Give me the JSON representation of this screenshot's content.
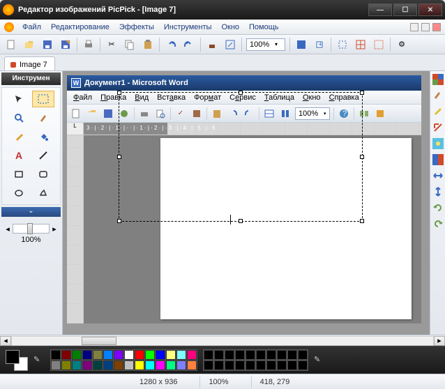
{
  "window": {
    "title": "Редактор изображений PicPick - [Image 7]"
  },
  "menu": {
    "file": "Файл",
    "edit": "Редактирование",
    "effects": "Эффекты",
    "tools": "Инструменты",
    "window": "Окно",
    "help": "Помощь"
  },
  "toolbar": {
    "zoom_value": "100%"
  },
  "tabs": {
    "tab1": "Image 7"
  },
  "toolpanel": {
    "header": "Инструмен",
    "size_value": "100%"
  },
  "embedded": {
    "title": "Документ1 - Microsoft Word",
    "menu": {
      "file": "Файл",
      "edit": "Правка",
      "view": "Вид",
      "insert": "Вставка",
      "format": "Формат",
      "service": "Сервис",
      "table": "Таблица",
      "window": "Окно",
      "help": "Справка"
    },
    "zoom": "100%",
    "ruler_text": "3 · | · 2 · | · 1 · | ·    · | · 1 · | · 2 · | · 3 · | · 4 · | · 5 · | · 6"
  },
  "palette": {
    "colors_row1": [
      "#000000",
      "#808080",
      "#800000",
      "#808000",
      "#008000",
      "#008080",
      "#000080",
      "#800080",
      "#808040",
      "#004040",
      "#0080ff",
      "#004080",
      "#8000ff",
      "#804000"
    ],
    "colors_row2": [
      "#ffffff",
      "#c0c0c0",
      "#ff0000",
      "#ffff00",
      "#00ff00",
      "#00ffff",
      "#0000ff",
      "#ff00ff",
      "#ffff80",
      "#00ff80",
      "#80ffff",
      "#8080ff",
      "#ff0080",
      "#ff8040"
    ]
  },
  "status": {
    "dimensions": "1280 x 936",
    "zoom": "100%",
    "position": "418, 279"
  }
}
